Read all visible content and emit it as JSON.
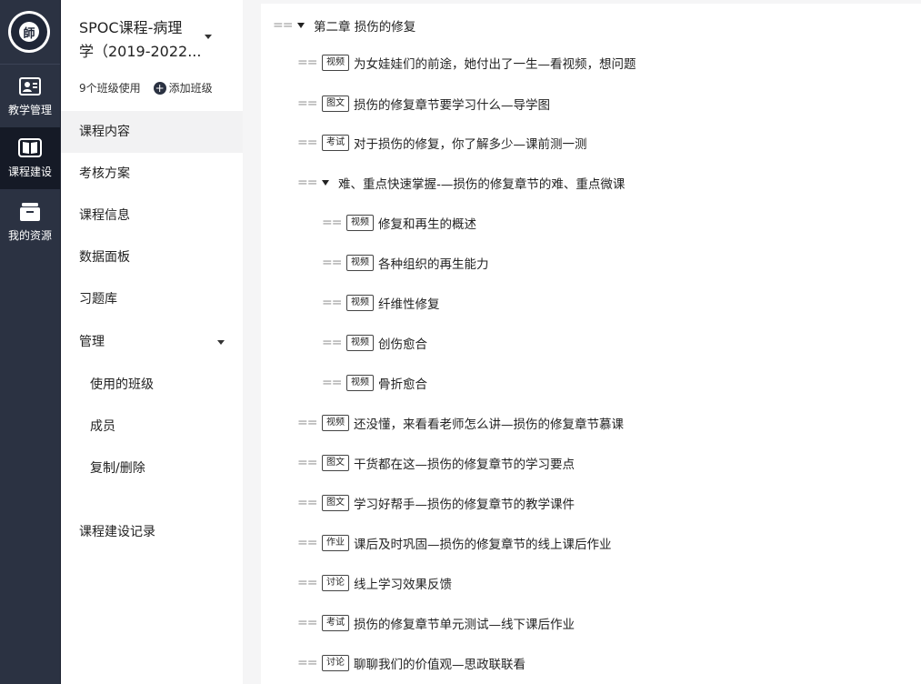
{
  "rail": {
    "logo_char": "師",
    "items": [
      {
        "label": "教学管理",
        "icon": "teaching-management-icon",
        "active": false
      },
      {
        "label": "课程建设",
        "icon": "book-icon",
        "active": true
      },
      {
        "label": "我的资源",
        "icon": "resource-box-icon",
        "active": false
      }
    ]
  },
  "course": {
    "title_line1": "SPOC课程-病理",
    "title_line2": "学（2019-2022...",
    "class_count": "9个班级使用",
    "add_class": "添加班级"
  },
  "menu": {
    "content": "课程内容",
    "assessment": "考核方案",
    "info": "课程信息",
    "dashboard": "数据面板",
    "question_bank": "习题库",
    "manage": "管理",
    "used_classes": "使用的班级",
    "members": "成员",
    "copy_delete": "复制/删除",
    "build_log": "课程建设记录"
  },
  "outline": {
    "chapter": "第二章 损伤的修复",
    "items": [
      {
        "tag": "视频",
        "title": "为女娃娃们的前途，她付出了一生—看视频，想问题"
      },
      {
        "tag": "图文",
        "title": "损伤的修复章节要学习什么—导学图"
      },
      {
        "tag": "考试",
        "title": "对于损伤的修复，你了解多少—课前测一测"
      },
      {
        "tag": "",
        "title": "难、重点快速掌握-—损伤的修复章节的难、重点微课"
      },
      {
        "tag": "视频",
        "title": "修复和再生的概述"
      },
      {
        "tag": "视频",
        "title": "各种组织的再生能力"
      },
      {
        "tag": "视频",
        "title": "纤维性修复"
      },
      {
        "tag": "视频",
        "title": "创伤愈合"
      },
      {
        "tag": "视频",
        "title": "骨折愈合"
      },
      {
        "tag": "视频",
        "title": "还没懂，来看看老师怎么讲—损伤的修复章节慕课"
      },
      {
        "tag": "图文",
        "title": "干货都在这—损伤的修复章节的学习要点"
      },
      {
        "tag": "图文",
        "title": "学习好帮手—损伤的修复章节的教学课件"
      },
      {
        "tag": "作业",
        "title": "课后及时巩固—损伤的修复章节的线上课后作业"
      },
      {
        "tag": "讨论",
        "title": "线上学习效果反馈"
      },
      {
        "tag": "考试",
        "title": "损伤的修复章节单元测试—线下课后作业"
      },
      {
        "tag": "讨论",
        "title": "聊聊我们的价值观—思政联联看"
      }
    ]
  }
}
